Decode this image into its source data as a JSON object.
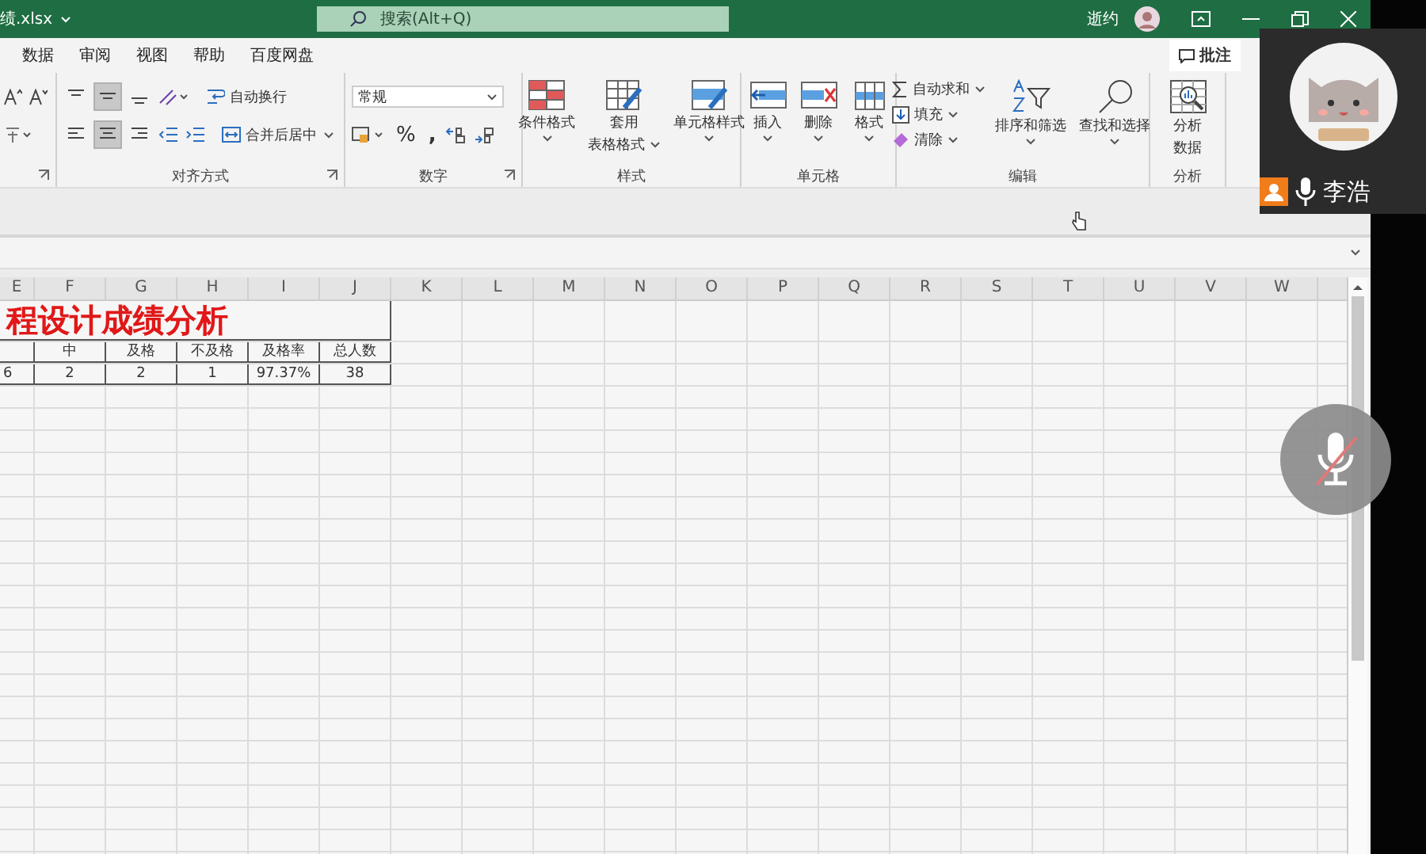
{
  "title_bar": {
    "file_name": "绩.xlsx",
    "search_placeholder": "搜索(Alt+Q)",
    "user_name": "逝约"
  },
  "ribbon_tabs": [
    "数据",
    "审阅",
    "视图",
    "帮助",
    "百度网盘"
  ],
  "comment_button": "批注",
  "alignment": {
    "vertical": [
      {
        "selected": false
      },
      {
        "selected": true
      },
      {
        "selected": false
      }
    ],
    "horizontal": [
      {
        "selected": false
      },
      {
        "selected": true
      },
      {
        "selected": false
      }
    ],
    "wrap_text": "自动换行",
    "merge_center": "合并后居中",
    "label": "对齐方式"
  },
  "number": {
    "format": "常规",
    "percent": "%",
    "comma": ",",
    "label": "数字"
  },
  "styles": {
    "conditional": "条件格式",
    "table_format": [
      "套用",
      "表格格式"
    ],
    "cell_styles": "单元格样式",
    "label": "样式"
  },
  "cells": {
    "insert": "插入",
    "delete": "删除",
    "format": "格式",
    "label": "单元格"
  },
  "editing": {
    "autosum": "自动求和",
    "fill": "填充",
    "clear": "清除",
    "sort_filter": "排序和筛选",
    "find_select": "查找和选择",
    "label": "编辑"
  },
  "analysis": {
    "analyze": [
      "分析",
      "数据"
    ],
    "label": "分析"
  },
  "sheet": {
    "columns": [
      "E",
      "F",
      "G",
      "H",
      "I",
      "J",
      "K",
      "L",
      "M",
      "N",
      "O",
      "P",
      "Q",
      "R",
      "S",
      "T",
      "U",
      "V",
      "W"
    ],
    "title": "程设计成绩分析",
    "header_row": [
      "中",
      "及格",
      "不及格",
      "及格率",
      "总人数"
    ],
    "value_row": [
      "6",
      "2",
      "2",
      "1",
      "97.37%",
      "38"
    ]
  },
  "video": {
    "participant": "李浩",
    "mic_muted": true
  }
}
